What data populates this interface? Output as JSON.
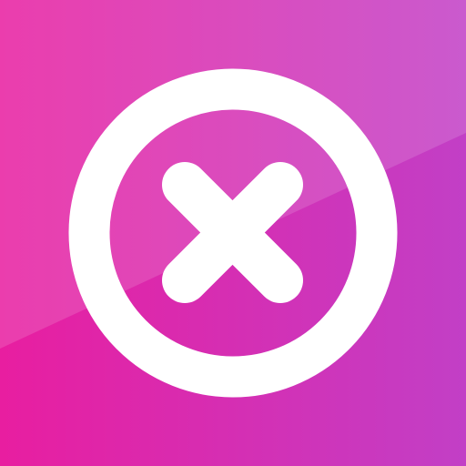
{
  "icon": {
    "name": "close-x-icon",
    "colors": {
      "gradient_left": "#E81EA0",
      "gradient_right": "#C23FC6",
      "highlight": "#FFFFFF",
      "glyph": "#FFFFFF"
    }
  }
}
